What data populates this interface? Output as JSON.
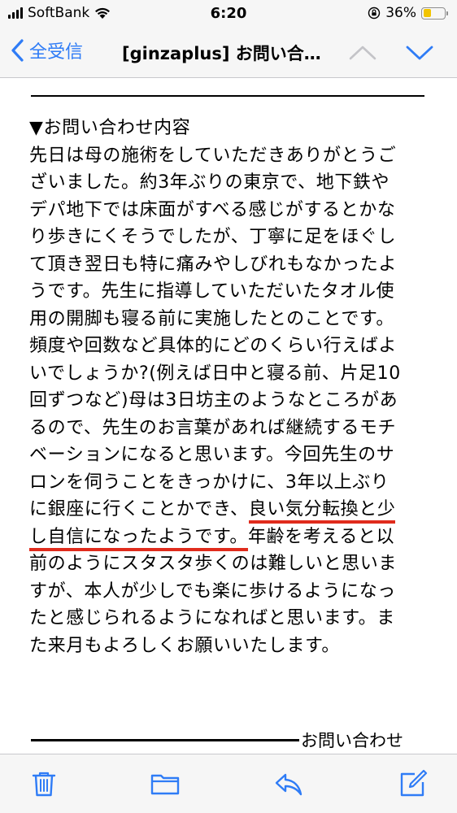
{
  "status_bar": {
    "carrier": "SoftBank",
    "time": "6:20",
    "battery": "36%",
    "battery_level": 0.36,
    "battery_color": "#f2c400"
  },
  "nav": {
    "back_label": "全受信",
    "title": "[ginzaplus] お問い合…",
    "accent_color": "#2f7cf6",
    "icons": [
      "chevron-left-icon",
      "chevron-up-icon",
      "chevron-down-icon"
    ]
  },
  "email": {
    "lines": [
      "▼お問い合わせ内容",
      "先日は母の施術をしていただきありがとうご",
      "ざいました。約3年ぶりの東京で、地下鉄や",
      "デパ地下では床面がすべる感じがするとかな",
      "り歩きにくそうでしたが、丁寧に足をほぐし",
      "て頂き翌日も特に痛みやしびれもなかったよ",
      "うです。先生に指導していただいたタオル使",
      "用の開脚も寝る前に実施したとのことです。",
      "頻度や回数など具体的にどのくらい行えばよ",
      "いでしょうか?(例えば日中と寝る前、片足10",
      "回ずつなど)母は3日坊主のようなところがあ",
      "るので、先生のお言葉があれば継続するモチ",
      "ベーションになると思います。今回先生のサ",
      "ロンを伺うことをきっかけに、3年以上ぶり"
    ],
    "line15_before": "に銀座に行くことかでき、",
    "line15_highlight": "良い気分転換と少",
    "line16_highlight": "し自信になったようです。",
    "line16_after": "年齢を考えると以",
    "lines_after": [
      "前のようにスタスタ歩くのは難しいと思いま",
      "すが、本人が少しでも楽に歩けるようになっ",
      "たと感じられるようになればと思います。ま",
      "た来月もよろしくお願いいたします。"
    ],
    "footer_label": "お問い合わせ",
    "highlight_color": "#e02b1c"
  },
  "toolbar": {
    "icons": [
      "trash-icon",
      "folder-icon",
      "reply-icon",
      "compose-icon"
    ],
    "icon_color": "#2f7cf6"
  }
}
